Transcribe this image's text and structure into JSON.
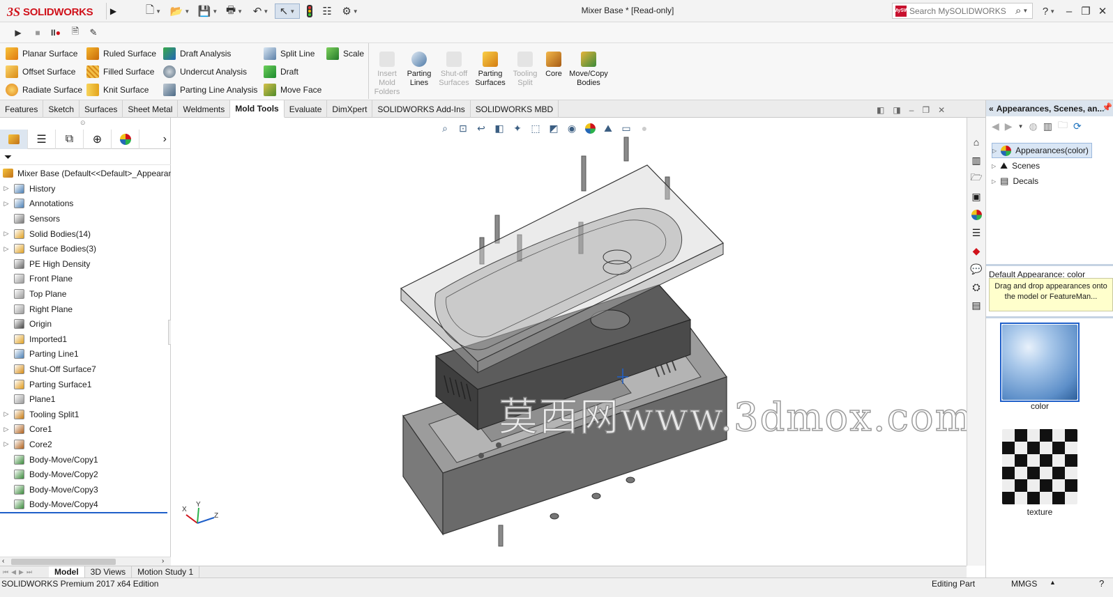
{
  "app": {
    "brand_prefix": "3S",
    "brand_name": "SOLIDWORKS",
    "doc_title": "Mixer Base * [Read-only]"
  },
  "search": {
    "placeholder": "Search MySOLIDWORKS",
    "badge": "MySW"
  },
  "window": {
    "help": "?",
    "minimize": "–",
    "restore": "❐",
    "close": "✕"
  },
  "command_manager": {
    "col1": [
      "Planar Surface",
      "Offset Surface",
      "Radiate Surface"
    ],
    "col2": [
      "Ruled Surface",
      "Filled Surface",
      "Knit Surface"
    ],
    "col3": [
      "Draft Analysis",
      "Undercut Analysis",
      "Parting Line Analysis"
    ],
    "col4": [
      "Split Line",
      "Draft",
      "Move Face"
    ],
    "col5": [
      "Scale"
    ],
    "big": [
      {
        "label": "Insert Mold Folders",
        "disabled": true
      },
      {
        "label": "Parting Lines",
        "disabled": false
      },
      {
        "label": "Shut-off Surfaces",
        "disabled": true
      },
      {
        "label": "Parting Surfaces",
        "disabled": false
      },
      {
        "label": "Tooling Split",
        "disabled": true
      },
      {
        "label": "Core",
        "disabled": false
      },
      {
        "label": "Move/Copy Bodies",
        "disabled": false
      }
    ]
  },
  "tabs": [
    "Features",
    "Sketch",
    "Surfaces",
    "Sheet Metal",
    "Weldments",
    "Mold Tools",
    "Evaluate",
    "DimXpert",
    "SOLIDWORKS Add-Ins",
    "SOLIDWORKS MBD"
  ],
  "active_tab": "Mold Tools",
  "feature_tree": {
    "root": "Mixer Base  (Default<<Default>_Appearan",
    "items": [
      {
        "label": "History",
        "expandable": true,
        "icon": "history-icon"
      },
      {
        "label": "Annotations",
        "expandable": true,
        "icon": "annotations-icon"
      },
      {
        "label": "Sensors",
        "expandable": false,
        "icon": "sensors-icon"
      },
      {
        "label": "Solid Bodies(14)",
        "expandable": true,
        "icon": "solid-bodies-icon"
      },
      {
        "label": "Surface Bodies(3)",
        "expandable": true,
        "icon": "surface-bodies-icon"
      },
      {
        "label": "PE High Density",
        "expandable": false,
        "icon": "material-icon"
      },
      {
        "label": "Front Plane",
        "expandable": false,
        "icon": "plane-icon"
      },
      {
        "label": "Top Plane",
        "expandable": false,
        "icon": "plane-icon"
      },
      {
        "label": "Right Plane",
        "expandable": false,
        "icon": "plane-icon"
      },
      {
        "label": "Origin",
        "expandable": false,
        "icon": "origin-icon"
      },
      {
        "label": "Imported1",
        "expandable": false,
        "icon": "imported-icon"
      },
      {
        "label": "Parting Line1",
        "expandable": false,
        "icon": "parting-line-icon"
      },
      {
        "label": "Shut-Off Surface7",
        "expandable": false,
        "icon": "shutoff-surface-icon"
      },
      {
        "label": "Parting Surface1",
        "expandable": false,
        "icon": "parting-surface-icon"
      },
      {
        "label": "Plane1",
        "expandable": false,
        "icon": "plane-icon"
      },
      {
        "label": "Tooling Split1",
        "expandable": true,
        "icon": "tooling-split-icon"
      },
      {
        "label": "Core1",
        "expandable": true,
        "icon": "core-icon"
      },
      {
        "label": "Core2",
        "expandable": true,
        "icon": "core-icon"
      },
      {
        "label": "Body-Move/Copy1",
        "expandable": false,
        "icon": "move-copy-icon"
      },
      {
        "label": "Body-Move/Copy2",
        "expandable": false,
        "icon": "move-copy-icon"
      },
      {
        "label": "Body-Move/Copy3",
        "expandable": false,
        "icon": "move-copy-icon"
      },
      {
        "label": "Body-Move/Copy4",
        "expandable": false,
        "icon": "move-copy-icon"
      }
    ]
  },
  "right_panel": {
    "title": "Appearances, Scenes, an...",
    "tree": [
      "Appearances(color)",
      "Scenes",
      "Decals"
    ],
    "default_label": "Default Appearance: color",
    "tooltip": "Drag and drop appearances onto the model or FeatureMan...",
    "swatches": [
      {
        "label": "color"
      },
      {
        "label": "texture"
      }
    ]
  },
  "triad": {
    "x": "X",
    "y": "Y",
    "z": "Z"
  },
  "watermark": "莫西网www.3dmox.com",
  "bottom_tabs": [
    "Model",
    "3D Views",
    "Motion Study 1"
  ],
  "status": {
    "edition": "SOLIDWORKS Premium 2017 x64 Edition",
    "mode": "Editing Part",
    "units": "MMGS"
  },
  "colors": {
    "accent": "#d0121b",
    "selection": "#1e5fc9",
    "tab_active": "#ffffff"
  }
}
